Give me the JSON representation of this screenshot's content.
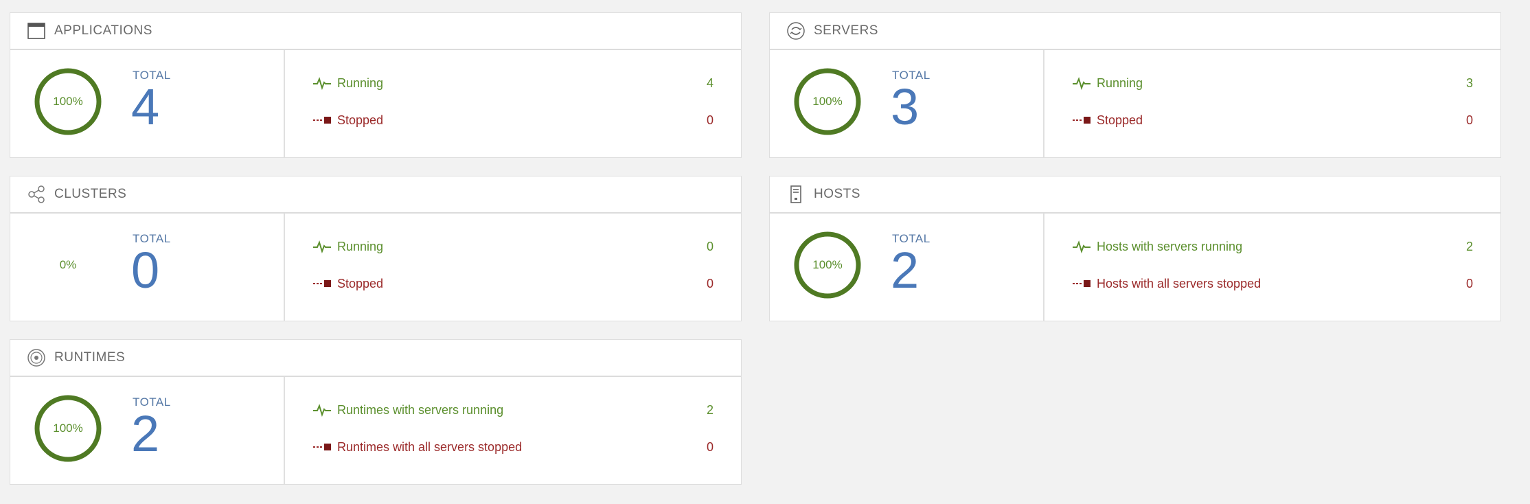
{
  "colors": {
    "ok": "#5b8f2d",
    "stopped": "#9b2a2a",
    "total": "#4a78b8",
    "ring": "#4f7a23"
  },
  "total_label": "TOTAL",
  "cards": {
    "applications": {
      "title": "APPLICATIONS",
      "icon": "window-icon",
      "percent_label": "100%",
      "percent": 100,
      "total": "4",
      "running_label": "Running",
      "running_value": "4",
      "stopped_label": "Stopped",
      "stopped_value": "0"
    },
    "servers": {
      "title": "SERVERS",
      "icon": "server-sync-icon",
      "percent_label": "100%",
      "percent": 100,
      "total": "3",
      "running_label": "Running",
      "running_value": "3",
      "stopped_label": "Stopped",
      "stopped_value": "0"
    },
    "clusters": {
      "title": "CLUSTERS",
      "icon": "share-nodes-icon",
      "percent_label": "0%",
      "percent": 0,
      "total": "0",
      "running_label": "Running",
      "running_value": "0",
      "stopped_label": "Stopped",
      "stopped_value": "0"
    },
    "hosts": {
      "title": "HOSTS",
      "icon": "host-tower-icon",
      "percent_label": "100%",
      "percent": 100,
      "total": "2",
      "running_label": "Hosts with servers running",
      "running_value": "2",
      "stopped_label": "Hosts with all servers stopped",
      "stopped_value": "0"
    },
    "runtimes": {
      "title": "RUNTIMES",
      "icon": "runtime-disc-icon",
      "percent_label": "100%",
      "percent": 100,
      "total": "2",
      "running_label": "Runtimes with servers running",
      "running_value": "2",
      "stopped_label": "Runtimes with all servers stopped",
      "stopped_value": "0"
    }
  }
}
